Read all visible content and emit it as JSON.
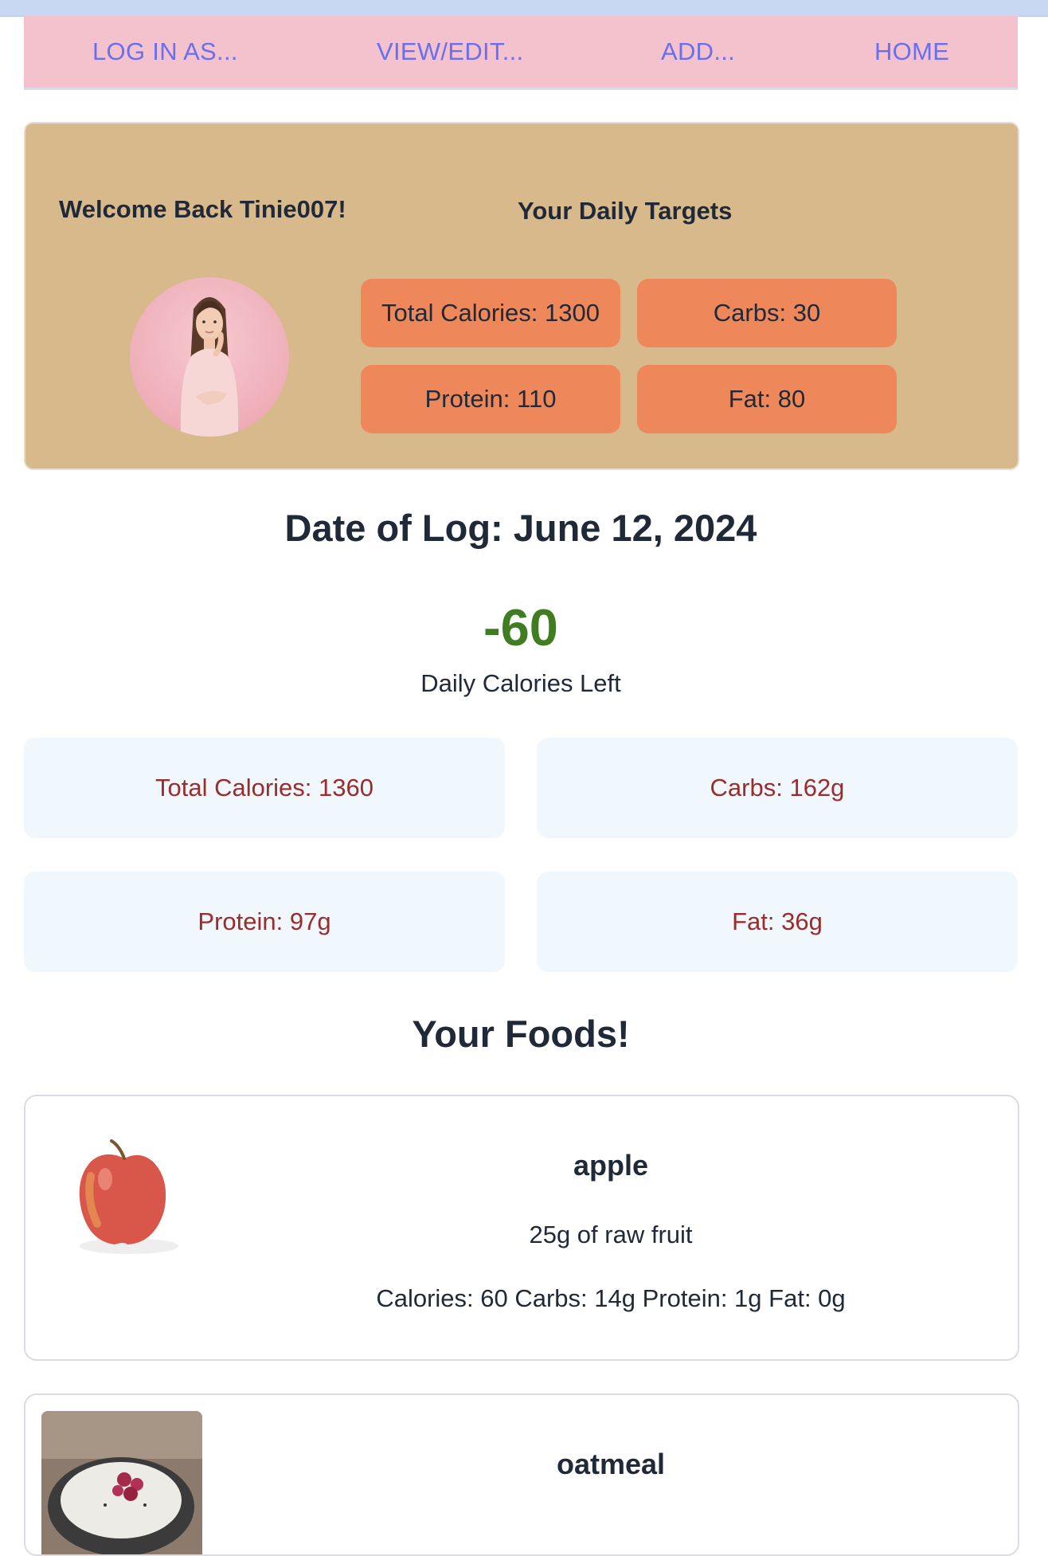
{
  "nav": {
    "items": [
      "LOG IN AS...",
      "VIEW/EDIT...",
      "ADD...",
      "HOME"
    ]
  },
  "profile": {
    "welcome": "Welcome Back Tinie007!",
    "targets_title": "Your Daily Targets",
    "avatar_icon": "user-avatar",
    "targets": {
      "calories": "Total Calories: 1300",
      "carbs": "Carbs: 30",
      "protein": "Protein: 110",
      "fat": "Fat: 80"
    }
  },
  "log": {
    "date": "Date of Log: June 12, 2024",
    "calories_left": "-60",
    "calories_left_label": "Daily Calories Left",
    "totals": {
      "calories": "Total Calories: 1360",
      "carbs": "Carbs: 162g",
      "protein": "Protein: 97g",
      "fat": "Fat: 36g"
    }
  },
  "foods": {
    "title": "Your Foods!",
    "items": [
      {
        "name": "apple",
        "serving": "25g of raw fruit",
        "macros": "Calories: 60 Carbs: 14g Protein: 1g Fat: 0g"
      },
      {
        "name": "oatmeal"
      }
    ]
  },
  "colors": {
    "nav_bg": "#f4c2cc",
    "nav_link": "#6a6ef0",
    "profile_bg": "#d8b98c",
    "target_bg": "#ee885a",
    "calories_left": "#3f7d20",
    "stat_text": "#9b2c2c",
    "stat_bg": "#f0f7fd"
  }
}
